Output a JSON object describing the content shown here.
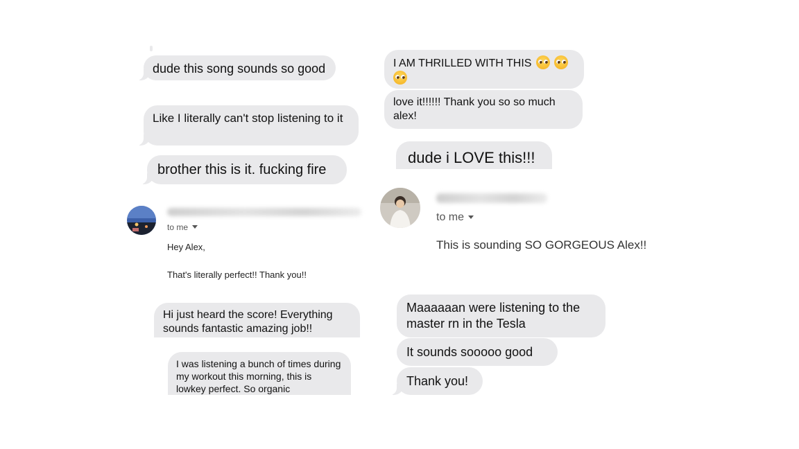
{
  "left_column": {
    "bubble_1": "dude this song sounds so good",
    "bubble_2": "Like I literally can't stop listening to it",
    "bubble_3": "brother this is it. fucking fire",
    "email": {
      "to_me": "to me",
      "greeting": "Hey Alex,",
      "body": "That's literally perfect!! Thank you!!"
    },
    "bubble_4": "Hi just heard the score! Everything sounds fantastic amazing job!!",
    "bubble_5": "I was listening a bunch of times during my workout this morning, this is lowkey perfect. So organic"
  },
  "right_column": {
    "bubble_1": "I AM THRILLED WITH THIS",
    "bubble_2": "love it!!!!!! Thank you so so much alex!",
    "bubble_3": "dude i LOVE this!!!",
    "email": {
      "to_me": "to me",
      "body": "This is sounding SO GORGEOUS Alex!!"
    },
    "bubble_4": "Maaaaaan were listening to the master rn in the Tesla",
    "bubble_5": "It sounds sooooo good",
    "bubble_6": "Thank you!"
  },
  "icons": {
    "emoji": "pleading-face-emoji",
    "caret": "chevron-down-icon"
  },
  "colors": {
    "bubble": "#e9e9eb",
    "background": "#ffffff"
  }
}
